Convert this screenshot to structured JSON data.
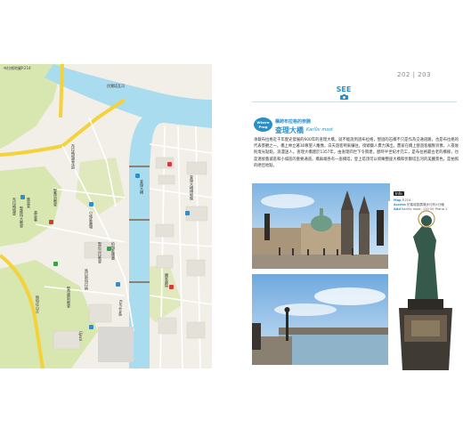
{
  "map": {
    "title": "布拉格地圖P.214",
    "labels": {
      "l1": "布拉格城堡",
      "l2": "聖維特大教堂",
      "l3": "舊皇宮",
      "l4": "黃金巷",
      "l5": "聖喬治教堂",
      "l6": "查理大橋",
      "l7": "小城區廣場",
      "l8": "聖尼古拉教堂",
      "l9": "伏爾塔瓦河",
      "l10": "佩特任山丘",
      "l11": "約翰藍儂牆",
      "l12": "Kampa島",
      "l13": "馬拉斯特拉納",
      "l14": "布拉格城堡花園",
      "l15": "聖母勝利教堂",
      "l16": "Újezd",
      "l17": "國家劇院",
      "l18": "查理大橋博物館"
    }
  },
  "page": {
    "number": "202 | 203",
    "section": "SEE",
    "section_icon": "camera-icon"
  },
  "article": {
    "bubble_text": "Where Prag",
    "subtitle": "橫跨布拉格的奈腕",
    "title": "查理大橋",
    "title_en": "Karlův most",
    "body": "承載布拉格近千年歷史發展的600年的查理大橋，就不能說到過布拉格，堅固的石橋不只是作為交通道路，也是布拉格的代表景觀之一。橋上林立著30尊聖人雕像，白天遊客熙來攘往，街頭藝人賣力演出，畫家在橋上替遊客繪製肖像，入夜後則燈光點點，浪漫迷人。查理大橋建於1357年，由查理四世下令興建，歷時半世紀才完工，是布拉格最古老的橋樑，也是連接舊城區和小城區的重要通道。橋兩端各有一座橋塔，登上塔頂可以俯瞰整座大橋和伏爾塔瓦河的美麗景色，是拍照的絕佳地點。"
  },
  "info": {
    "tag": "Info",
    "rows": [
      {
        "key": "Map",
        "value": "P.214"
      },
      {
        "key": "Access",
        "value": "於舊城區廣場步行約5分鐘"
      },
      {
        "key": "Add",
        "value": "Karlův most, 110 00 Praha 1"
      }
    ]
  },
  "colors": {
    "accent": "#2a8fc8",
    "river": "#a9dcef",
    "park": "#d8e6b0",
    "road_major": "#f3d23a"
  }
}
